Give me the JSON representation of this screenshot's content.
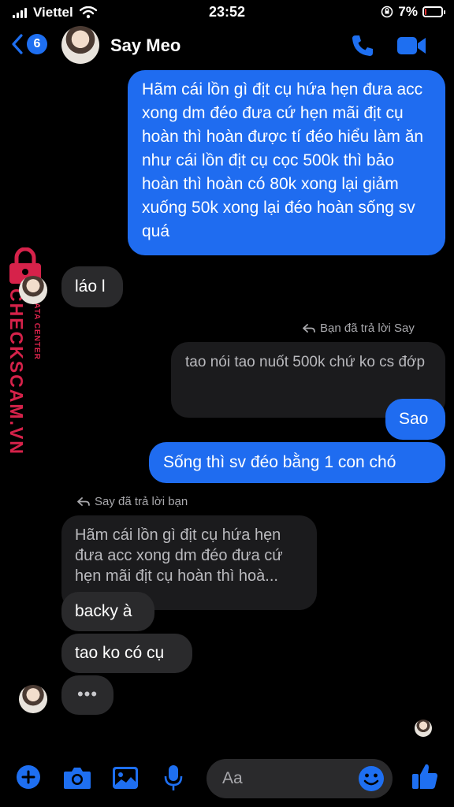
{
  "status_bar": {
    "carrier": "Viettel",
    "time": "23:52",
    "battery": "7%",
    "battery_level": 0.07
  },
  "header": {
    "back_count": "6",
    "contact_name": "Say Meo",
    "icons": [
      "chevron-left-icon",
      "phone-icon",
      "video-camera-icon"
    ]
  },
  "messages": [
    {
      "from": "me",
      "text": "Hãm cái lồn gì địt cụ hứa hẹn đưa acc xong dm đéo đưa cứ hẹn mãi địt cụ hoàn thì hoàn được tí đéo hiểu làm ăn như cái lồn địt cụ cọc 500k thì bảo hoàn thì hoàn có 80k xong lại giảm xuống 50k xong lại đéo hoàn sống sv quá"
    },
    {
      "from": "them",
      "text": "láo l"
    },
    {
      "reply_note": "Bạn đã trả lời Say",
      "quoted": "tao nói tao nuốt 500k chứ ko cs đớp"
    },
    {
      "from": "me",
      "text": "Sao"
    },
    {
      "from": "me",
      "text": "Sống thì sv đéo bằng 1 con chó"
    },
    {
      "reply_note": "Say đã trả lời bạn",
      "quoted": "Hãm cái lồn gì địt cụ hứa hẹn đưa acc xong dm đéo đưa cứ hẹn mãi địt cụ hoàn thì hoà..."
    },
    {
      "from": "them",
      "text": "backy à"
    },
    {
      "from": "them",
      "text": "tao ko có cụ"
    },
    {
      "from": "them",
      "text": "•••",
      "typing": true
    }
  ],
  "watermark": {
    "brand": "CHECKSCAM.VN",
    "sub": "DATA CENTER",
    "color": "#d6224a"
  },
  "composer": {
    "placeholder": "Aa",
    "icons": [
      "plus-icon",
      "camera-icon",
      "image-icon",
      "microphone-icon",
      "emoji-icon",
      "thumbs-up-icon"
    ]
  },
  "colors": {
    "accent": "#1f6cf0",
    "incoming_bubble": "#2a2a2c",
    "background": "#000000"
  }
}
